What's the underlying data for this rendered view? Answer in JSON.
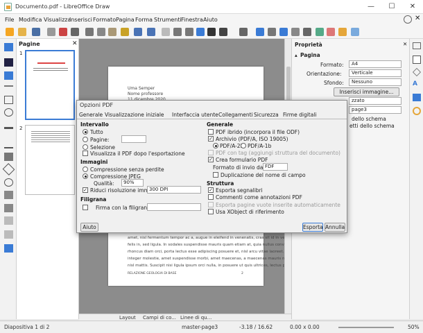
{
  "window": {
    "title": "Documento.pdf - LibreOffice Draw",
    "minimize": "—",
    "maximize": "☐",
    "close": "✕"
  },
  "menu": [
    "File",
    "Modifica",
    "Visualizza",
    "Inserisci",
    "Formato",
    "Pagina",
    "Forma",
    "Strumenti",
    "Finestra",
    "Aiuto"
  ],
  "pages_panel": {
    "title": "Pagine",
    "close": "✕",
    "page_numbers": [
      "1",
      "2"
    ]
  },
  "document": {
    "lines": [
      "Uma Semper",
      "Nome professore",
      "11 dicembre 2020"
    ],
    "body": [
      "amet, nisl fermentum tempor ac a, augue in eleifend in venenatis, cras sit id in vestibulum",
      "felis in, sed ligula. In sodales suspendisse mauris quam etiam at, quia nullus convallis eros,",
      "rhoncus diam orci, porta lectus esse adipiscing posuere et, nisl arcu vitae laoreet. Morbi",
      "integer molestie, amet suspendisse morbi, amet maecenas, a maecenas mauris neque sed",
      "nisl mattis. Suscipit nisi ligula ipsum orci nulla, in posuere ut quis ultrices, lectus primis."
    ],
    "footer_left": "RELAZIONE GEOLOGIA DI BASE",
    "footer_right": "2"
  },
  "bottom_tabs": [
    "Layout",
    "Campi di co...",
    "Linee di qu..."
  ],
  "properties": {
    "title": "Proprietà",
    "section": "Pagina",
    "format_label": "Formato:",
    "format_value": "A4",
    "orientation_label": "Orientazione:",
    "orientation_value": "Verticale",
    "background_label": "Sfondo:",
    "background_value": "Nessuno",
    "insert_image": "Inserisci immagine...",
    "combo_partial": "zzato",
    "master_value": "page3",
    "line1": "dello schema",
    "line2": "etti dello schema"
  },
  "status": {
    "slide": "Diapositiva 1 di 2",
    "master": "master-page3",
    "position": "-3.18 / 16.62",
    "size": "0.00 x 0.00",
    "zoom": "50%"
  },
  "dialog": {
    "title": "Opzioni PDF",
    "tabs": [
      "Generale",
      "Visualizzazione iniziale",
      "Interfaccia utente",
      "Collegamenti",
      "Sicurezza",
      "Firme digitali"
    ],
    "range": {
      "title": "Intervallo",
      "all": "Tutto",
      "pages": "Pagine:",
      "selection": "Selezione",
      "view_after": "Visualizza il PDF dopo l'esportazione"
    },
    "images": {
      "title": "Immagini",
      "lossless": "Compressione senza perdite",
      "jpeg": "Compressione JPEG",
      "quality_label": "Qualità:",
      "quality_value": "90%",
      "reduce": "Riduci risoluzione immagine",
      "dpi_value": "300 DPI"
    },
    "watermark": {
      "title": "Filigrana",
      "sign": "Firma con la filigrana"
    },
    "general": {
      "title": "Generale",
      "hybrid": "PDF ibrido (incorpora il file ODF)",
      "archive": "Archivio (PDF/A, ISO 19005)",
      "pdfa2b": "PDF/A-2b",
      "pdfa1b": "PDF/A-1b",
      "tagged": "PDF con tag (aggiungi struttura del documento)",
      "form": "Crea formulario PDF",
      "submit_label": "Formato di invio dati:",
      "submit_value": "FDF",
      "dup": "Duplicazione del nome di campo"
    },
    "structure": {
      "title": "Struttura",
      "bookmarks": "Esporta segnalibri",
      "comments": "Commenti come annotazioni PDF",
      "empty_pages": "Esporta pagine vuote inserite automaticamente",
      "xobject": "Usa XObject di riferimento"
    },
    "help": "Aiuto",
    "export": "Esporta",
    "cancel": "Annulla"
  }
}
